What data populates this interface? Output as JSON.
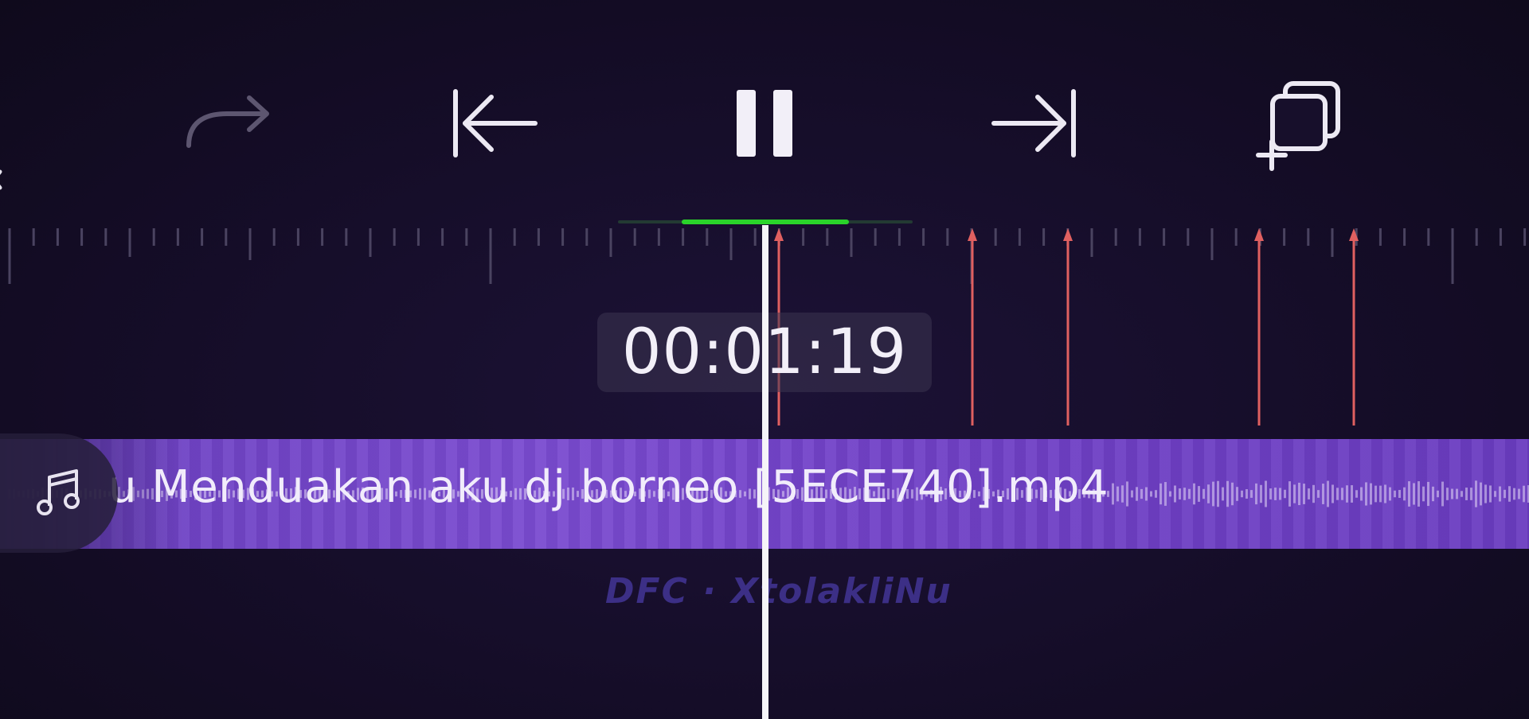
{
  "toolbar": {
    "buttons": [
      {
        "name": "redo",
        "icon": "redo-arrow-icon"
      },
      {
        "name": "skip-to-start",
        "icon": "skip-start-icon"
      },
      {
        "name": "pause",
        "icon": "pause-icon"
      },
      {
        "name": "skip-to-end",
        "icon": "skip-end-icon"
      },
      {
        "name": "add-clip",
        "icon": "add-layer-icon"
      }
    ]
  },
  "timeline": {
    "current_time": "00:01:19",
    "playback_progress": 0.35,
    "accent_color": "#2ad32a",
    "marker_color": "#e06060"
  },
  "audio_track": {
    "label": "u Menduakan aku dj borneo [5ECE740].mp4",
    "icon": "music-note-icon",
    "color": "#7a4bd0"
  },
  "watermark": "DFC · XtolakliNu"
}
